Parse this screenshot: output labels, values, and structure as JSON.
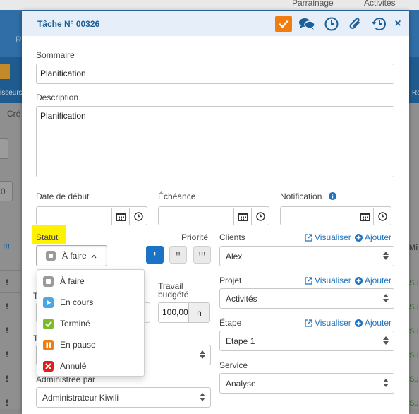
{
  "background": {
    "top_links": [
      "Parrainage",
      "Activités"
    ],
    "row1_text": "R",
    "row2_text_left": "isseurs",
    "row2_text_right": "Ro",
    "list_label": "Cré",
    "list_label_2": "0",
    "list_col_mark": "!!!",
    "list_col_right": "Mi",
    "list_marks": [
      "!",
      "!",
      "!",
      "!",
      "!",
      "!"
    ],
    "list_status": [
      "Su",
      "Su",
      "Su",
      "Su",
      "Su",
      "Su"
    ]
  },
  "modal": {
    "title": "Tâche N° 00326",
    "header_icons": [
      "check-icon",
      "comment-icon",
      "clock-icon",
      "paperclip-icon",
      "history-icon",
      "close-icon"
    ],
    "close_glyph": "×",
    "sommaire": {
      "label": "Sommaire",
      "value": "Planification"
    },
    "description": {
      "label": "Description",
      "value": "Planification"
    },
    "date_debut": {
      "label": "Date de début",
      "value": ""
    },
    "echeance": {
      "label": "Échéance",
      "value": ""
    },
    "notification": {
      "label": "Notification",
      "value": ""
    },
    "statut": {
      "label": "Statut",
      "value": "À faire"
    },
    "priorite": {
      "label": "Priorité",
      "levels": [
        "!",
        "!!",
        "!!!"
      ],
      "selected": 0
    },
    "clients": {
      "label": "Clients",
      "value": "Alex"
    },
    "projet": {
      "label": "Projet",
      "value": "Activités"
    },
    "etape": {
      "label": "Étape",
      "value": "Etape 1"
    },
    "service": {
      "label": "Service",
      "value": "Analyse"
    },
    "travail_budgete": {
      "label_line1": "Travail",
      "label_line2": "budgété",
      "value": "100,00",
      "unit": "h"
    },
    "administre_par": {
      "label": "Administrée par",
      "value": "Administrateur Kiwili"
    },
    "partial_label_1": "T",
    "partial_label_2": "T",
    "links": {
      "visualiser": "Visualiser",
      "ajouter": "Ajouter"
    },
    "status_options": [
      {
        "label": "À faire",
        "color": "#9a9a9a",
        "icon": "square-icon"
      },
      {
        "label": "En cours",
        "color": "#4aa7e0",
        "icon": "play-icon"
      },
      {
        "label": "Terminé",
        "color": "#7cba2a",
        "icon": "check-icon"
      },
      {
        "label": "En pause",
        "color": "#ef7d12",
        "icon": "pause-icon"
      },
      {
        "label": "Annulé",
        "color": "#e01e1e",
        "icon": "x-icon"
      }
    ],
    "colors": {
      "accent": "#1c74c0",
      "header_bg": "#e6eff9",
      "highlight": "#fff200",
      "check_orange": "#ef7d12"
    }
  }
}
